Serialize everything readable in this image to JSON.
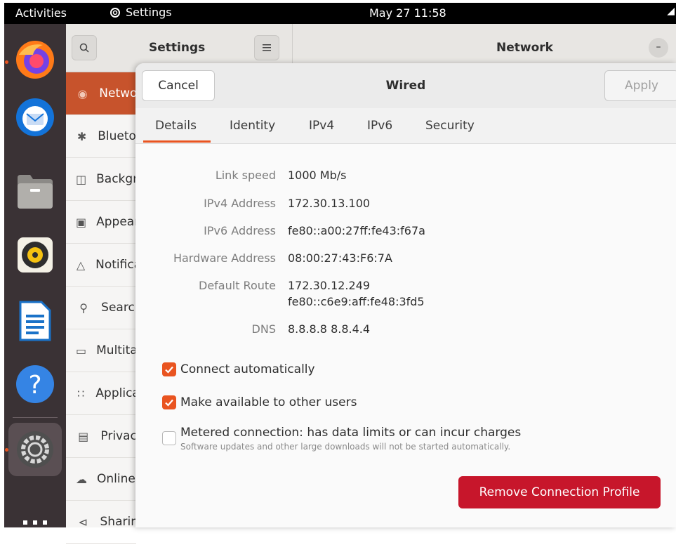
{
  "topbar": {
    "activities": "Activities",
    "app_name": "Settings",
    "clock": "May 27  11:58",
    "tray_icon": "network-icon"
  },
  "dock": {
    "items": [
      "firefox",
      "thunderbird",
      "files",
      "rhythmbox",
      "libreoffice-writer",
      "help",
      "settings",
      "app-grid"
    ]
  },
  "settings": {
    "sidebar_title": "Settings",
    "main_title": "Network",
    "sidebar_items": [
      {
        "label": "Network",
        "icon": "network-icon"
      },
      {
        "label": "Bluetooth",
        "icon": "bluetooth-icon"
      },
      {
        "label": "Background",
        "icon": "background-icon"
      },
      {
        "label": "Appearance",
        "icon": "appearance-icon"
      },
      {
        "label": "Notifications",
        "icon": "bell-icon"
      },
      {
        "label": "Search",
        "icon": "search-icon"
      },
      {
        "label": "Multitasking",
        "icon": "multitasking-icon"
      },
      {
        "label": "Applications",
        "icon": "apps-icon"
      },
      {
        "label": "Privacy",
        "icon": "lock-icon"
      },
      {
        "label": "Online Accounts",
        "icon": "cloud-icon"
      },
      {
        "label": "Sharing",
        "icon": "share-icon"
      }
    ]
  },
  "dialog": {
    "cancel": "Cancel",
    "title": "Wired",
    "apply": "Apply",
    "tabs": [
      "Details",
      "Identity",
      "IPv4",
      "IPv6",
      "Security"
    ],
    "active_tab": "Details",
    "details": {
      "link_speed_label": "Link speed",
      "link_speed": "1000 Mb/s",
      "ipv4_label": "IPv4 Address",
      "ipv4": "172.30.13.100",
      "ipv6_label": "IPv6 Address",
      "ipv6": "fe80::a00:27ff:fe43:f67a",
      "hw_label": "Hardware Address",
      "hw": "08:00:27:43:F6:7A",
      "route_label": "Default Route",
      "route_1": "172.30.12.249",
      "route_2": "fe80::c6e9:aff:fe48:3fd5",
      "dns_label": "DNS",
      "dns": "8.8.8.8 8.8.4.4"
    },
    "options": {
      "connect_auto": "Connect automatically",
      "connect_auto_checked": true,
      "available_users": "Make available to other users",
      "available_users_checked": true,
      "metered": "Metered connection: has data limits or can incur charges",
      "metered_sub": "Software updates and other large downloads will not be started automatically.",
      "metered_checked": false
    },
    "remove": "Remove Connection Profile"
  },
  "colors": {
    "accent": "#e95420",
    "destructive": "#c7162b",
    "dock_bg": "#3a3235",
    "selected_sidebar": "#c7532c"
  }
}
